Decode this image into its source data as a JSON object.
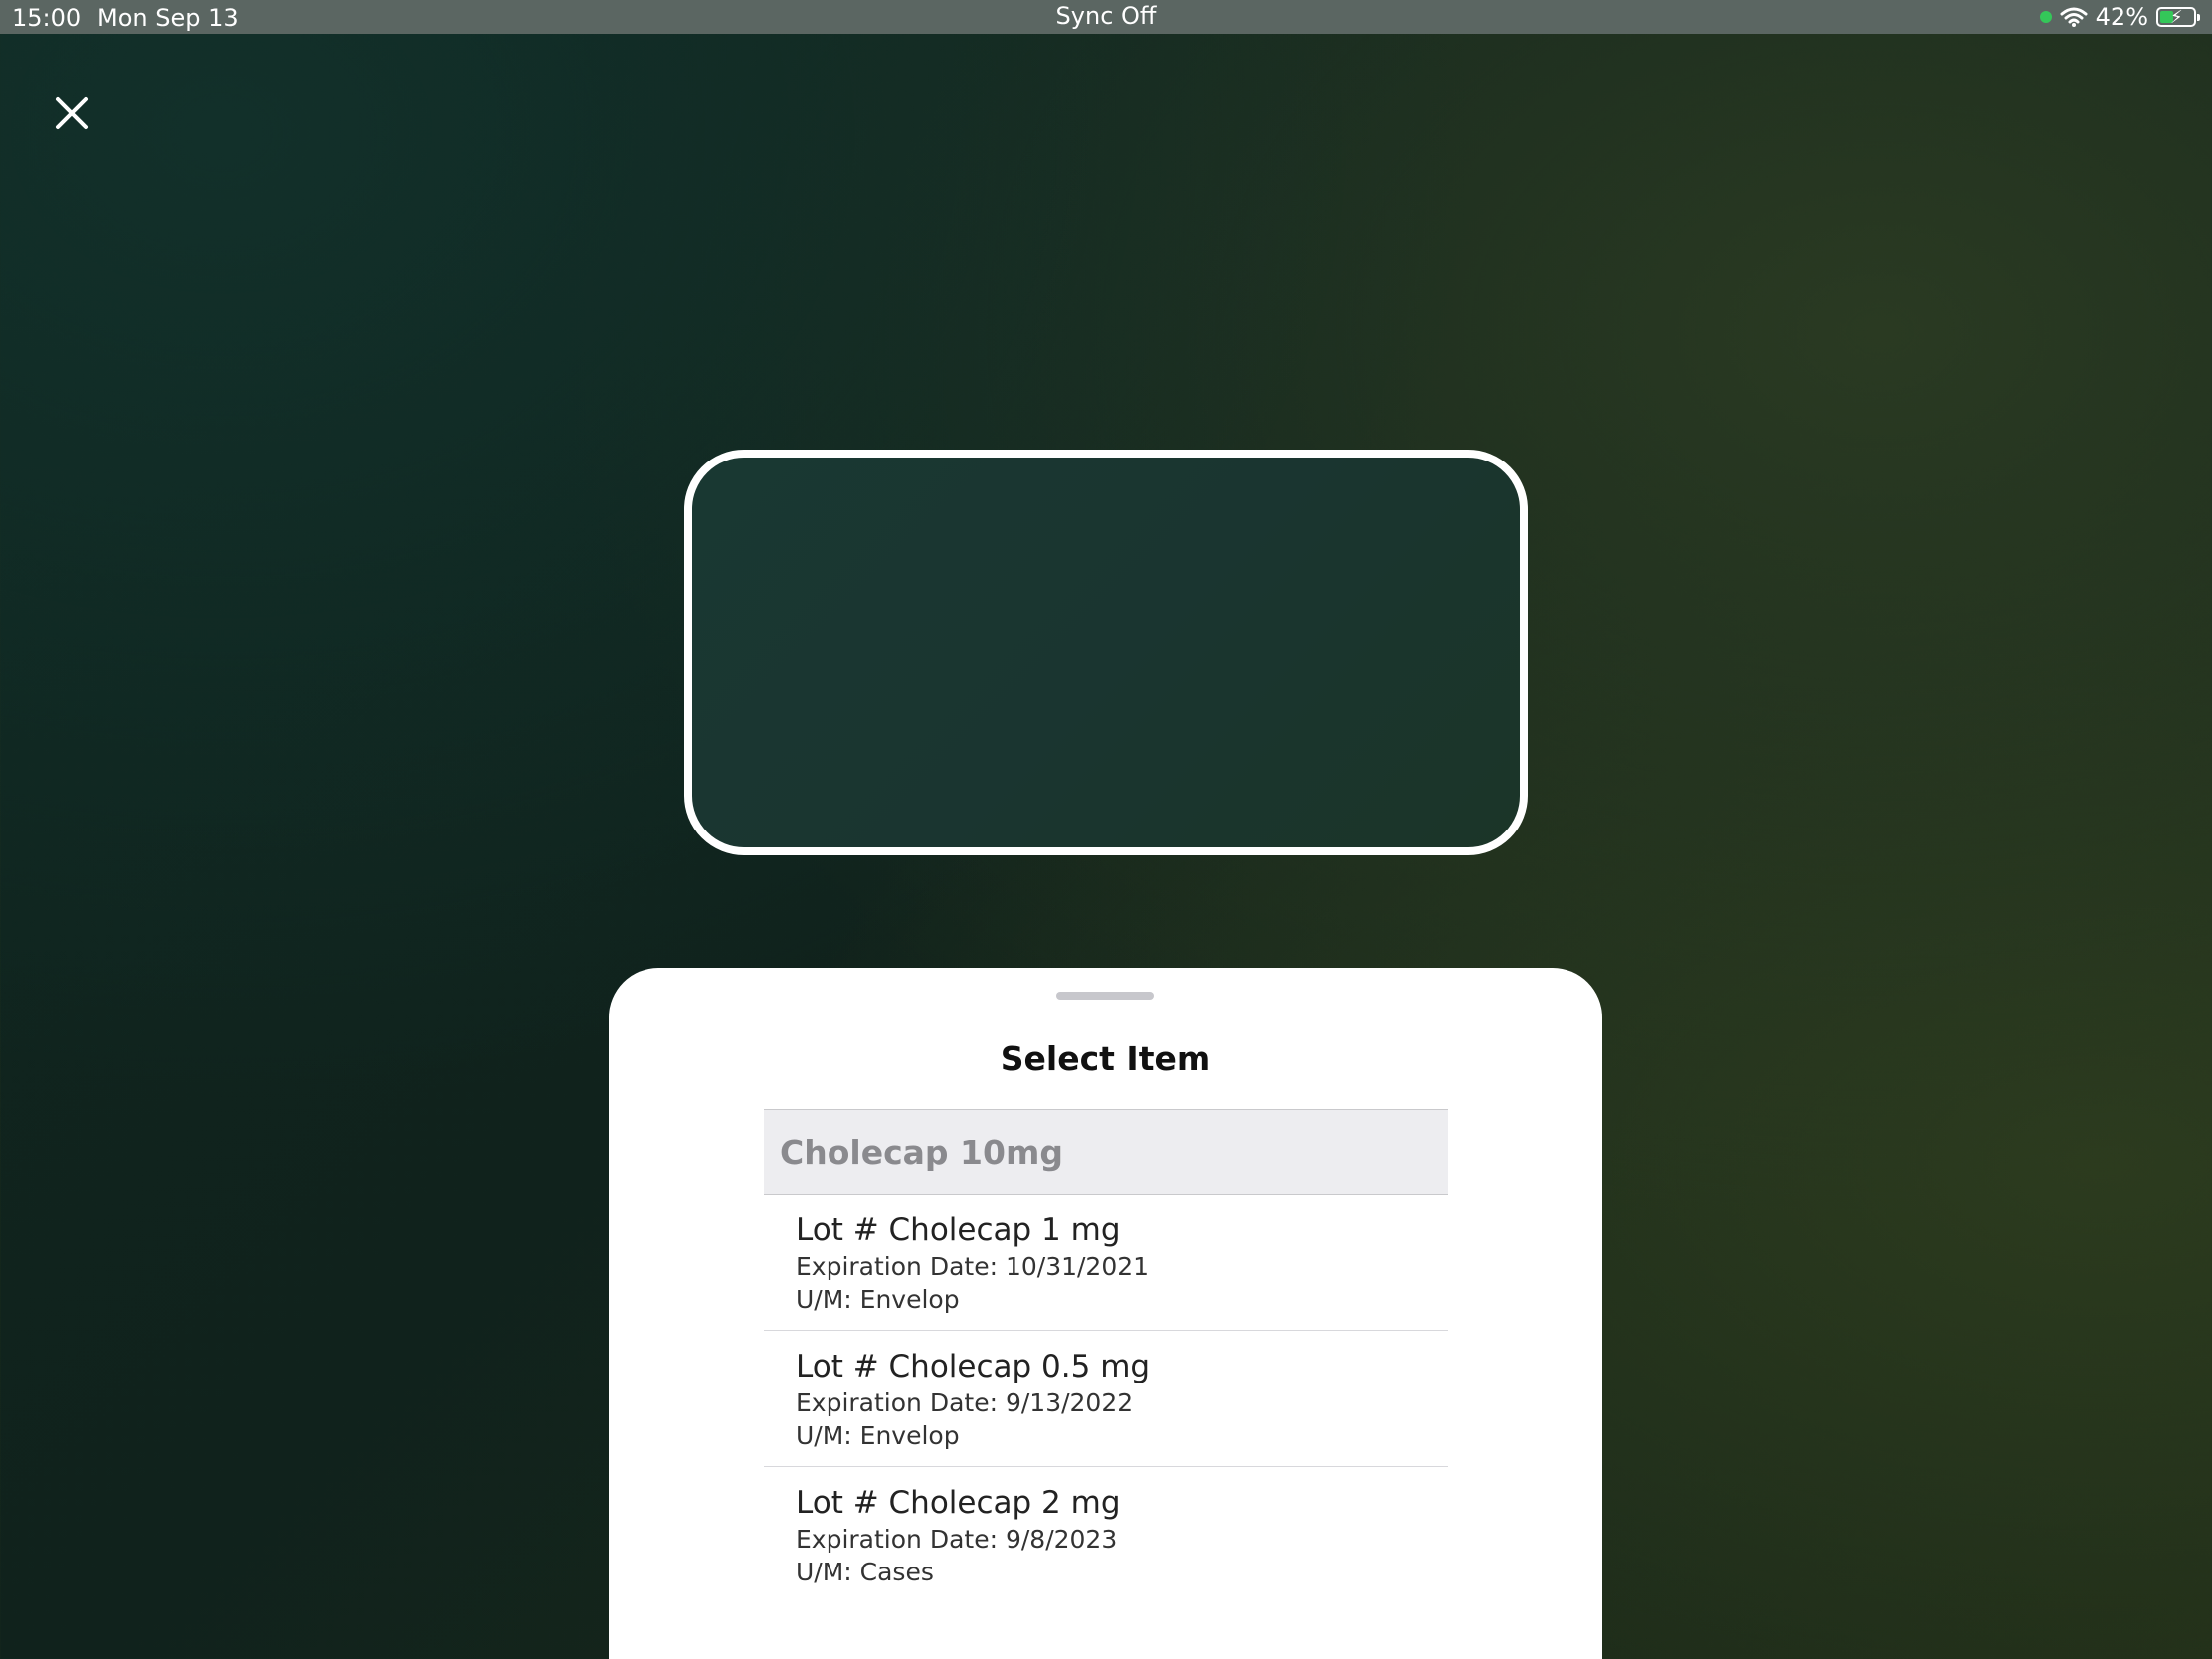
{
  "status_bar": {
    "time": "15:00",
    "date": "Mon Sep 13",
    "center_text": "Sync Off",
    "battery_percent": "42%",
    "battery_level": 0.42,
    "charging": true
  },
  "colors": {
    "status_green": "#34c759",
    "sheet_background": "#ffffff",
    "section_header_bg": "#ededf0"
  },
  "icons": {
    "close": "close-icon",
    "wifi": "wifi-icon",
    "battery": "battery-icon"
  },
  "sheet": {
    "title": "Select Item",
    "section_header": "Cholecap 10mg",
    "items": [
      {
        "lot": "Lot # Cholecap 1 mg",
        "expiration": "Expiration Date: 10/31/2021",
        "um": "U/M: Envelop"
      },
      {
        "lot": "Lot # Cholecap 0.5 mg",
        "expiration": "Expiration Date: 9/13/2022",
        "um": "U/M: Envelop"
      },
      {
        "lot": "Lot # Cholecap 2 mg",
        "expiration": "Expiration Date: 9/8/2023",
        "um": "U/M: Cases"
      }
    ]
  }
}
